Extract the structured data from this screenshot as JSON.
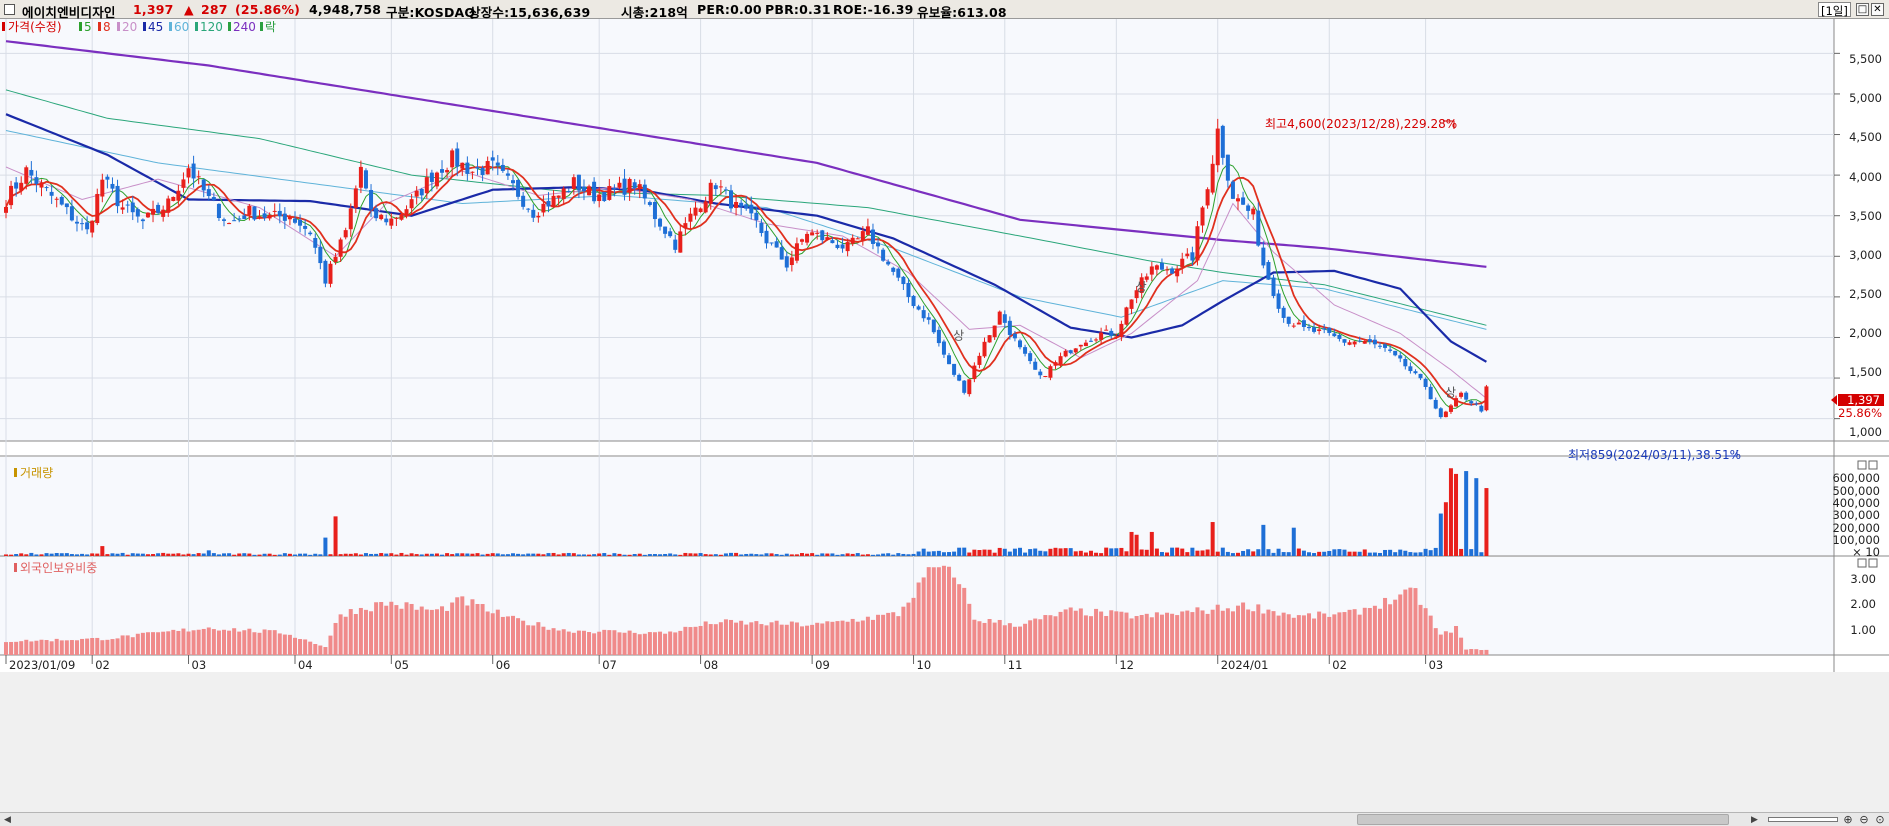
{
  "header": {
    "name": "에이치엔비디자인",
    "price": "1,397",
    "change_arrow": "▲",
    "change": "287",
    "change_pct": "(25.86%)",
    "volume": "4,948,758",
    "market": "구분:KOSDAQ",
    "shares": "상장수:15,636,639",
    "cap": "시총:218억",
    "per": "PER:0.00",
    "pbr": "PBR:0.31",
    "roe": "ROE:-16.39",
    "reserve": "유보율:613.08",
    "timeframe": "[1일]"
  },
  "legend": [
    {
      "label": "가격(수정)",
      "color": "#d40000"
    },
    {
      "label": "5",
      "color": "#2ca02c"
    },
    {
      "label": "8",
      "color": "#e0301e"
    },
    {
      "label": "20",
      "color": "#c88fc8"
    },
    {
      "label": "45",
      "color": "#1a2aa8"
    },
    {
      "label": "60",
      "color": "#5fb3d9"
    },
    {
      "label": "120",
      "color": "#2aa67a"
    },
    {
      "label": "240",
      "color": "#2aa040"
    },
    {
      "label": "락",
      "color": "#2aa040"
    }
  ],
  "volume_panel_title": "거래량",
  "foreign_panel_title": "외국인보유비중",
  "price_axis": [
    "5,500",
    "5,000",
    "4,500",
    "4,000",
    "3,500",
    "3,000",
    "2,500",
    "2,000",
    "1,500",
    "1,000"
  ],
  "volume_axis": [
    "600,000",
    "500,000",
    "400,000",
    "300,000",
    "200,000",
    "100,000"
  ],
  "volume_axis_unit": "× 10",
  "foreign_axis": [
    "3.00",
    "2.00",
    "1.00"
  ],
  "last_price_tag": "1,397",
  "last_change_tag": "25.86%",
  "annotations": {
    "high": "최고4,600(2023/12/28),229.28%",
    "low": "최저859(2024/03/11),38.51%",
    "marker": "상"
  },
  "date_labels": [
    {
      "label": "2023/01/09",
      "i": 0
    },
    {
      "label": "02",
      "i": 17
    },
    {
      "label": "03",
      "i": 36
    },
    {
      "label": "04",
      "i": 57
    },
    {
      "label": "05",
      "i": 76
    },
    {
      "label": "06",
      "i": 96
    },
    {
      "label": "07",
      "i": 117
    },
    {
      "label": "08",
      "i": 137
    },
    {
      "label": "09",
      "i": 159
    },
    {
      "label": "10",
      "i": 179
    },
    {
      "label": "11",
      "i": 197
    },
    {
      "label": "12",
      "i": 219
    },
    {
      "label": "2024/01",
      "i": 239
    },
    {
      "label": "02",
      "i": 261
    },
    {
      "label": "03",
      "i": 280
    }
  ],
  "colors": {
    "up": "#e8201c",
    "down": "#1e6fd6",
    "ma5": "#2ca02c",
    "ma8": "#e0301e",
    "ma20": "#c88fc8",
    "ma45": "#1a2aa8",
    "ma60": "#5fb3d9",
    "ma120": "#2aa67a",
    "ma240": "#7b2fbf",
    "foreign": "#f08a8a",
    "panel_bg": "#f7f9fd",
    "grid": "#d8dde6"
  },
  "chart_data": {
    "type": "candlestick",
    "n": 293,
    "price_ylim": [
      700,
      5800
    ],
    "anchors": [
      [
        0,
        3700
      ],
      [
        4,
        4050
      ],
      [
        12,
        3550
      ],
      [
        16,
        3300
      ],
      [
        19,
        3950
      ],
      [
        23,
        3600
      ],
      [
        27,
        3420
      ],
      [
        32,
        3650
      ],
      [
        36,
        4100
      ],
      [
        40,
        3700
      ],
      [
        44,
        3400
      ],
      [
        48,
        3550
      ],
      [
        52,
        3480
      ],
      [
        56,
        3500
      ],
      [
        60,
        3300
      ],
      [
        63,
        2700
      ],
      [
        67,
        3300
      ],
      [
        70,
        4100
      ],
      [
        72,
        3500
      ],
      [
        76,
        3450
      ],
      [
        80,
        3650
      ],
      [
        84,
        4000
      ],
      [
        88,
        4200
      ],
      [
        92,
        4050
      ],
      [
        96,
        4100
      ],
      [
        100,
        3850
      ],
      [
        104,
        3550
      ],
      [
        108,
        3700
      ],
      [
        112,
        3900
      ],
      [
        116,
        3750
      ],
      [
        120,
        3800
      ],
      [
        124,
        3900
      ],
      [
        128,
        3500
      ],
      [
        132,
        3150
      ],
      [
        136,
        3600
      ],
      [
        140,
        3900
      ],
      [
        144,
        3600
      ],
      [
        148,
        3400
      ],
      [
        150,
        3200
      ],
      [
        154,
        2900
      ],
      [
        158,
        3300
      ],
      [
        162,
        3200
      ],
      [
        166,
        3100
      ],
      [
        170,
        3300
      ],
      [
        174,
        2900
      ],
      [
        178,
        2500
      ],
      [
        182,
        2200
      ],
      [
        186,
        1650
      ],
      [
        189,
        1350
      ],
      [
        192,
        1800
      ],
      [
        196,
        2300
      ],
      [
        200,
        1850
      ],
      [
        204,
        1500
      ],
      [
        208,
        1750
      ],
      [
        212,
        1950
      ],
      [
        216,
        2050
      ],
      [
        219,
        2050
      ],
      [
        222,
        2500
      ],
      [
        226,
        2850
      ],
      [
        230,
        2850
      ],
      [
        234,
        3000
      ],
      [
        238,
        4200
      ],
      [
        239,
        4550
      ],
      [
        242,
        3750
      ],
      [
        246,
        3500
      ],
      [
        248,
        2900
      ],
      [
        252,
        2250
      ],
      [
        256,
        2100
      ],
      [
        260,
        2050
      ],
      [
        264,
        1950
      ],
      [
        268,
        1950
      ],
      [
        272,
        1850
      ],
      [
        276,
        1650
      ],
      [
        280,
        1400
      ],
      [
        283,
        1000
      ],
      [
        287,
        1300
      ],
      [
        291,
        1110
      ],
      [
        292,
        1397
      ]
    ],
    "ma_anchors": {
      "ma240": [
        [
          0,
          5650
        ],
        [
          40,
          5350
        ],
        [
          80,
          4950
        ],
        [
          120,
          4550
        ],
        [
          160,
          4150
        ],
        [
          200,
          3450
        ],
        [
          240,
          3200
        ],
        [
          260,
          3100
        ],
        [
          292,
          2870
        ]
      ],
      "ma120": [
        [
          0,
          5050
        ],
        [
          20,
          4700
        ],
        [
          50,
          4450
        ],
        [
          80,
          4000
        ],
        [
          110,
          3800
        ],
        [
          140,
          3750
        ],
        [
          170,
          3600
        ],
        [
          200,
          3250
        ],
        [
          225,
          2950
        ],
        [
          240,
          2800
        ],
        [
          260,
          2650
        ],
        [
          292,
          2150
        ]
      ],
      "ma60": [
        [
          0,
          4550
        ],
        [
          30,
          4150
        ],
        [
          60,
          3900
        ],
        [
          90,
          3650
        ],
        [
          120,
          3750
        ],
        [
          150,
          3600
        ],
        [
          175,
          3100
        ],
        [
          200,
          2500
        ],
        [
          220,
          2250
        ],
        [
          240,
          2700
        ],
        [
          260,
          2600
        ],
        [
          292,
          2100
        ]
      ],
      "ma45": [
        [
          0,
          4750
        ],
        [
          20,
          4250
        ],
        [
          36,
          3700
        ],
        [
          60,
          3680
        ],
        [
          80,
          3500
        ],
        [
          96,
          3820
        ],
        [
          112,
          3850
        ],
        [
          125,
          3820
        ],
        [
          140,
          3650
        ],
        [
          160,
          3500
        ],
        [
          175,
          3220
        ],
        [
          195,
          2650
        ],
        [
          210,
          2120
        ],
        [
          222,
          2000
        ],
        [
          232,
          2150
        ],
        [
          240,
          2450
        ],
        [
          250,
          2800
        ],
        [
          262,
          2820
        ],
        [
          275,
          2600
        ],
        [
          285,
          1950
        ],
        [
          292,
          1700
        ]
      ],
      "ma20": [
        [
          0,
          4100
        ],
        [
          15,
          3700
        ],
        [
          30,
          3950
        ],
        [
          50,
          3600
        ],
        [
          65,
          3000
        ],
        [
          75,
          3650
        ],
        [
          90,
          4050
        ],
        [
          105,
          3750
        ],
        [
          120,
          3850
        ],
        [
          135,
          3700
        ],
        [
          150,
          3400
        ],
        [
          165,
          3250
        ],
        [
          178,
          2800
        ],
        [
          190,
          2100
        ],
        [
          200,
          2150
        ],
        [
          212,
          1750
        ],
        [
          222,
          2050
        ],
        [
          235,
          2700
        ],
        [
          242,
          3650
        ],
        [
          250,
          3050
        ],
        [
          262,
          2400
        ],
        [
          275,
          2050
        ],
        [
          285,
          1600
        ],
        [
          292,
          1250
        ]
      ]
    },
    "volume_ylim": [
      0,
      650000
    ],
    "volume_values_sample": "approximate",
    "foreign_ylim": [
      0,
      3.5
    ],
    "high": {
      "index": 239,
      "value": 4600,
      "date": "2023/12/28"
    },
    "low": {
      "index": 283,
      "value": 859,
      "date": "2024/03/11"
    }
  }
}
